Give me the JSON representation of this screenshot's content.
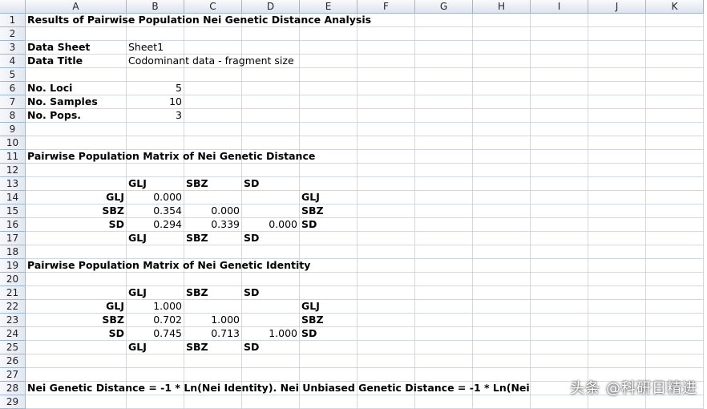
{
  "columns": [
    "A",
    "B",
    "C",
    "D",
    "E",
    "F",
    "G",
    "H",
    "I",
    "J",
    "K"
  ],
  "row_numbers": [
    "1",
    "2",
    "3",
    "4",
    "5",
    "6",
    "7",
    "8",
    "9",
    "10",
    "11",
    "12",
    "13",
    "14",
    "15",
    "16",
    "17",
    "18",
    "19",
    "20",
    "21",
    "22",
    "23",
    "24",
    "25",
    "26",
    "27",
    "28",
    "29"
  ],
  "cells": {
    "r1_title": "Results of Pairwise Population Nei Genetic Distance Analysis",
    "r3_label": "Data Sheet",
    "r3_value": "Sheet1",
    "r4_label": "Data Title",
    "r4_value": "Codominant data - fragment size",
    "r6_label": "No. Loci",
    "r6_value": "5",
    "r7_label": "No. Samples",
    "r7_value": "10",
    "r8_label": "No. Pops.",
    "r8_value": "3",
    "r11_title": "Pairwise Population Matrix of Nei Genetic Distance",
    "r19_title": "Pairwise Population Matrix of Nei Genetic Identity",
    "r28_note": "Nei Genetic Distance = -1 * Ln(Nei Identity).  Nei Unbiased Genetic Distance = -1 * Ln(Nei"
  },
  "distance_matrix": {
    "pops": [
      "GLJ",
      "SBZ",
      "SD"
    ],
    "rows": [
      [
        "0.000",
        "",
        ""
      ],
      [
        "0.354",
        "0.000",
        ""
      ],
      [
        "0.294",
        "0.339",
        "0.000"
      ]
    ]
  },
  "identity_matrix": {
    "pops": [
      "GLJ",
      "SBZ",
      "SD"
    ],
    "rows": [
      [
        "1.000",
        "",
        ""
      ],
      [
        "0.702",
        "1.000",
        ""
      ],
      [
        "0.745",
        "0.713",
        "1.000"
      ]
    ]
  },
  "watermark": "头条 @科研日精进"
}
